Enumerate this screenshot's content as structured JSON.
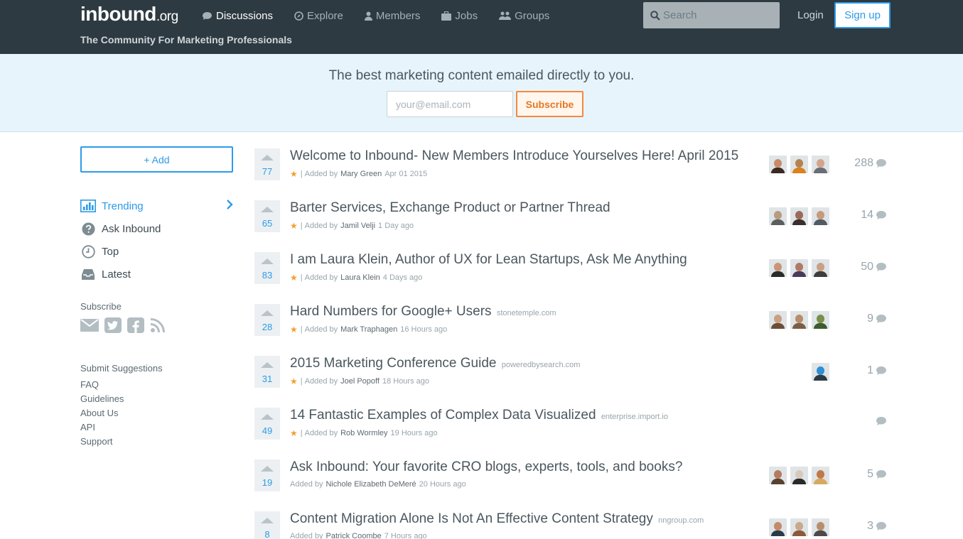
{
  "header": {
    "logo": "inbound",
    "logo_suffix": ".org",
    "tagline": "The Community For Marketing Professionals",
    "nav": [
      {
        "label": "Discussions",
        "icon": "chat-bubble-icon",
        "active": true
      },
      {
        "label": "Explore",
        "icon": "compass-icon",
        "active": false
      },
      {
        "label": "Members",
        "icon": "user-icon",
        "active": false
      },
      {
        "label": "Jobs",
        "icon": "briefcase-icon",
        "active": false
      },
      {
        "label": "Groups",
        "icon": "users-group-icon",
        "active": false
      }
    ],
    "search_placeholder": "Search",
    "login_label": "Login",
    "signup_label": "Sign up"
  },
  "banner": {
    "title": "The best marketing content emailed directly to you.",
    "email_placeholder": "your@email.com",
    "subscribe_label": "Subscribe"
  },
  "sidebar": {
    "add_label": "+ Add",
    "nav": [
      {
        "label": "Trending",
        "icon": "bar-chart-icon",
        "active": true
      },
      {
        "label": "Ask Inbound",
        "icon": "question-circle-icon",
        "active": false
      },
      {
        "label": "Top",
        "icon": "clock-icon",
        "active": false
      },
      {
        "label": "Latest",
        "icon": "inbox-icon",
        "active": false
      }
    ],
    "subscribe_label": "Subscribe",
    "social_icons": [
      "email-icon",
      "twitter-icon",
      "facebook-icon",
      "rss-icon"
    ],
    "links": [
      "Submit Suggestions",
      "FAQ",
      "Guidelines",
      "About Us",
      "API",
      "Support"
    ]
  },
  "posts": [
    {
      "votes": "77",
      "title": "Welcome to Inbound- New Members Introduce Yourselves Here! April 2015",
      "domain": "",
      "starred": true,
      "added_by": "Added by",
      "author": "Mary Green",
      "time": "Apr 01 2015",
      "comments": "288",
      "avatars": 3
    },
    {
      "votes": "65",
      "title": "Barter Services, Exchange Product or Partner Thread",
      "domain": "",
      "starred": true,
      "added_by": "Added by",
      "author": "Jamil Velji",
      "time": "1 Day ago",
      "comments": "14",
      "avatars": 3
    },
    {
      "votes": "83",
      "title": "I am Laura Klein, Author of UX for Lean Startups, Ask Me Anything",
      "domain": "",
      "starred": true,
      "added_by": "Added by",
      "author": "Laura Klein",
      "time": "4 Days ago",
      "comments": "50",
      "avatars": 3
    },
    {
      "votes": "28",
      "title": "Hard Numbers for Google+ Users",
      "domain": "stonetemple.com",
      "starred": true,
      "added_by": "Added by",
      "author": "Mark Traphagen",
      "time": "16 Hours ago",
      "comments": "9",
      "avatars": 3
    },
    {
      "votes": "31",
      "title": "2015 Marketing Conference Guide",
      "domain": "poweredbysearch.com",
      "starred": true,
      "added_by": "Added by",
      "author": "Joel Popoff",
      "time": "18 Hours ago",
      "comments": "1",
      "avatars": 1
    },
    {
      "votes": "49",
      "title": "14 Fantastic Examples of Complex Data Visualized",
      "domain": "enterprise.import.io",
      "starred": true,
      "added_by": "Added by",
      "author": "Rob Wormley",
      "time": "19 Hours ago",
      "comments": "",
      "avatars": 0
    },
    {
      "votes": "19",
      "title": "Ask Inbound: Your favorite CRO blogs, experts, tools, and books?",
      "domain": "",
      "starred": false,
      "added_by": "Added by",
      "author": "Nichole Elizabeth DeMeré",
      "time": "20 Hours ago",
      "comments": "5",
      "avatars": 3
    },
    {
      "votes": "8",
      "title": "Content Migration Alone Is Not An Effective Content Strategy",
      "domain": "nngroup.com",
      "starred": false,
      "added_by": "Added by",
      "author": "Patrick Coombe",
      "time": "7 Hours ago",
      "comments": "3",
      "avatars": 3
    }
  ],
  "colors": {
    "header_bg": "#2d3a41",
    "accent": "#2d9be8",
    "banner_bg": "#e7f4fc",
    "subscribe_orange": "#e87722",
    "star": "#f0a030"
  }
}
